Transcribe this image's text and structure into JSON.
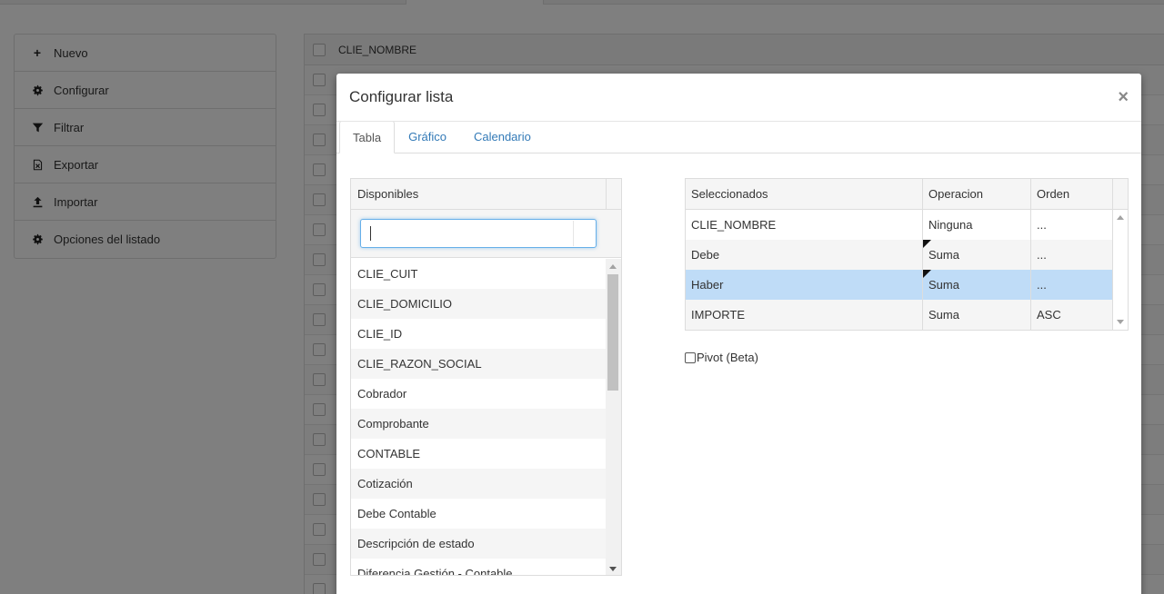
{
  "side_menu": {
    "items": [
      {
        "label": "Nuevo",
        "icon": "plus-icon"
      },
      {
        "label": "Configurar",
        "icon": "gear-icon"
      },
      {
        "label": "Filtrar",
        "icon": "filter-icon"
      },
      {
        "label": "Exportar",
        "icon": "excel-icon"
      },
      {
        "label": "Importar",
        "icon": "upload-icon"
      },
      {
        "label": "Opciones del listado",
        "icon": "gear-icon"
      }
    ]
  },
  "bg_table": {
    "header_label": "CLIE_NOMBRE"
  },
  "modal": {
    "title": "Configurar lista",
    "close_label": "×",
    "tabs": [
      "Tabla",
      "Gráfico",
      "Calendario"
    ],
    "active_tab": "Tabla"
  },
  "disponibles": {
    "header": "Disponibles",
    "filter_value": "",
    "items": [
      "CLIE_CUIT",
      "CLIE_DOMICILIO",
      "CLIE_ID",
      "CLIE_RAZON_SOCIAL",
      "Cobrador",
      "Comprobante",
      "CONTABLE",
      "Cotización",
      "Debe Contable",
      "Descripción de estado",
      "Diferencia Gestión - Contable"
    ]
  },
  "seleccionados": {
    "headers": [
      "Seleccionados",
      "Operacion",
      "Orden"
    ],
    "rows": [
      {
        "campo": "CLIE_NOMBRE",
        "operacion": "Ninguna",
        "orden": "...",
        "dirty": false,
        "selected": false
      },
      {
        "campo": "Debe",
        "operacion": "Suma",
        "orden": "...",
        "dirty": true,
        "selected": false
      },
      {
        "campo": "Haber",
        "operacion": "Suma",
        "orden": "...",
        "dirty": true,
        "selected": true
      },
      {
        "campo": "IMPORTE",
        "operacion": "Suma",
        "orden": "ASC",
        "dirty": false,
        "selected": false
      }
    ]
  },
  "pivot": {
    "label": "Pivot (Beta)",
    "checked": false
  },
  "colors": {
    "link": "#337ab7",
    "selected_row": "#bfdcf7",
    "focus_border": "#66afe9"
  }
}
